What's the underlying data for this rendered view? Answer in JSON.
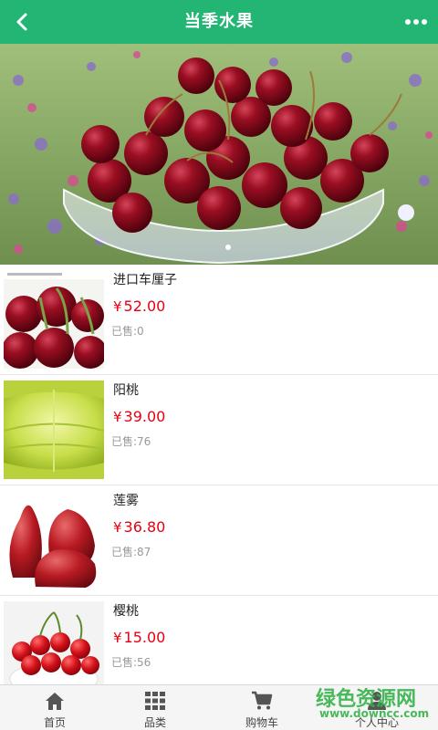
{
  "header": {
    "title": "当季水果"
  },
  "colors": {
    "brand": "#22b573",
    "price": "#e60012",
    "sold": "#999999"
  },
  "products": [
    {
      "name": "进口车厘子",
      "currency": "¥",
      "price": "52.00",
      "sold": "已售:0",
      "thumb_icon": "cherries-photo"
    },
    {
      "name": "阳桃",
      "currency": "¥",
      "price": "39.00",
      "sold": "已售:76",
      "thumb_icon": "starfruit-photo"
    },
    {
      "name": "莲雾",
      "currency": "¥",
      "price": "36.80",
      "sold": "已售:87",
      "thumb_icon": "wax-apple-photo"
    },
    {
      "name": "樱桃",
      "currency": "¥",
      "price": "15.00",
      "sold": "已售:56",
      "thumb_icon": "cherry-bowl-photo"
    }
  ],
  "tabbar": {
    "items": [
      {
        "label": "首页",
        "icon": "home-icon"
      },
      {
        "label": "品类",
        "icon": "grid-icon"
      },
      {
        "label": "购物车",
        "icon": "cart-icon"
      },
      {
        "label": "个人中心",
        "icon": "user-icon"
      }
    ]
  },
  "watermark": {
    "text": "绿色资源网",
    "url": "www.downcc.com"
  }
}
